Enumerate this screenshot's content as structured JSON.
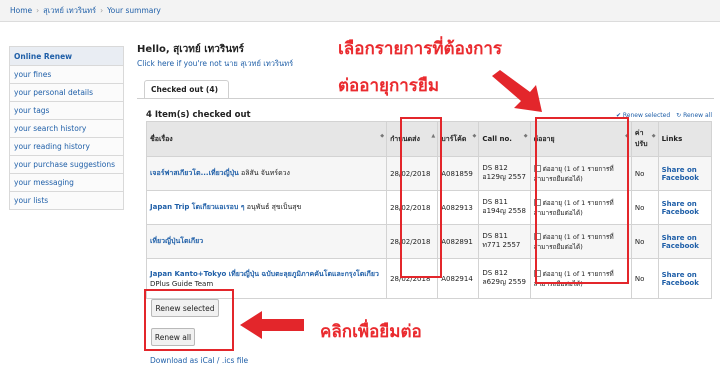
{
  "breadcrumb": {
    "home": "Home",
    "user": "สุเวทย์ เทวรินทร์",
    "current": "Your summary"
  },
  "sidebar": {
    "items": [
      {
        "label": "Online Renew",
        "active": true
      },
      {
        "label": "your fines"
      },
      {
        "label": "your personal details"
      },
      {
        "label": "your tags"
      },
      {
        "label": "your search history"
      },
      {
        "label": "your reading history"
      },
      {
        "label": "your purchase suggestions"
      },
      {
        "label": "your messaging"
      },
      {
        "label": "your lists"
      }
    ]
  },
  "greeting": "Hello, สุเวทย์ เทวรินทร์",
  "not_you_link": "Click here if you're not นาย สุเวทย์ เทวรินทร์",
  "tab_label": "Checked out (4)",
  "items_count": "4 Item(s) checked out",
  "renew_selected_link": "Renew selected",
  "renew_all_link": "Renew all",
  "table": {
    "headers": [
      "ชื่อเรื่อง",
      "กำหนดส่ง",
      "บาร์โค้ด",
      "Call no.",
      "ต่ออายุ",
      "ค่าปรับ",
      "Links"
    ],
    "rows": [
      {
        "title": "เจอร์ฟาสเกียวโต...เที่ยวญี่ปุ่น",
        "author": "อลิสัน จันทร์ดวง",
        "due": "28/02/2018",
        "barcode": "A081859",
        "call1": "DS 812",
        "call2": "อ129ญ 2557",
        "renew": "ต่ออายุ (1 of 1 รายการที่สามารถยืมต่อได้)",
        "fines": "No",
        "links": "Share on Facebook"
      },
      {
        "title": "Japan Trip โตเกียวแอเรอบ ๆ",
        "author": "อนุพันธ์ สุขเป็นสุข",
        "due": "28/02/2018",
        "barcode": "A082913",
        "call1": "DS 811",
        "call2": "อ194ญ 2558",
        "renew": "ต่ออายุ (1 of 1 รายการที่สามารถยืมต่อได้)",
        "fines": "No",
        "links": "Share on Facebook"
      },
      {
        "title": "เที่ยวญี่ปุ่นโตเกียว",
        "author": "",
        "due": "28/02/2018",
        "barcode": "A082891",
        "call1": "DS 811",
        "call2": "ท771 2557",
        "renew": "ต่ออายุ (1 of 1 รายการที่สามารถยืมต่อได้)",
        "fines": "No",
        "links": "Share on Facebook"
      },
      {
        "title": "Japan Kanto+Tokyo เที่ยวญี่ปุ่น ฉบับตะลุยภูมิภาคคันโตและกรุงโตเกียว",
        "author": "DPlus Guide Team",
        "due": "28/02/2018",
        "barcode": "A082914",
        "call1": "DS 812",
        "call2": "ล629ญ 2559",
        "renew": "ต่ออายุ (1 of 1 รายการที่สามารถยืมต่อได้)",
        "fines": "No",
        "links": "Share on Facebook"
      }
    ]
  },
  "buttons": {
    "renew_selected": "Renew selected",
    "renew_all": "Renew all"
  },
  "download_link": "Download as iCal / .ics file",
  "annotations": {
    "line1": "เลือกรายการที่ต้องการ",
    "line2": "ต่ออายุการยืม",
    "click_note": "คลิกเพื่อยืมต่อ"
  },
  "colors": {
    "highlight": "#e3262b",
    "link": "#1f5fa8"
  }
}
